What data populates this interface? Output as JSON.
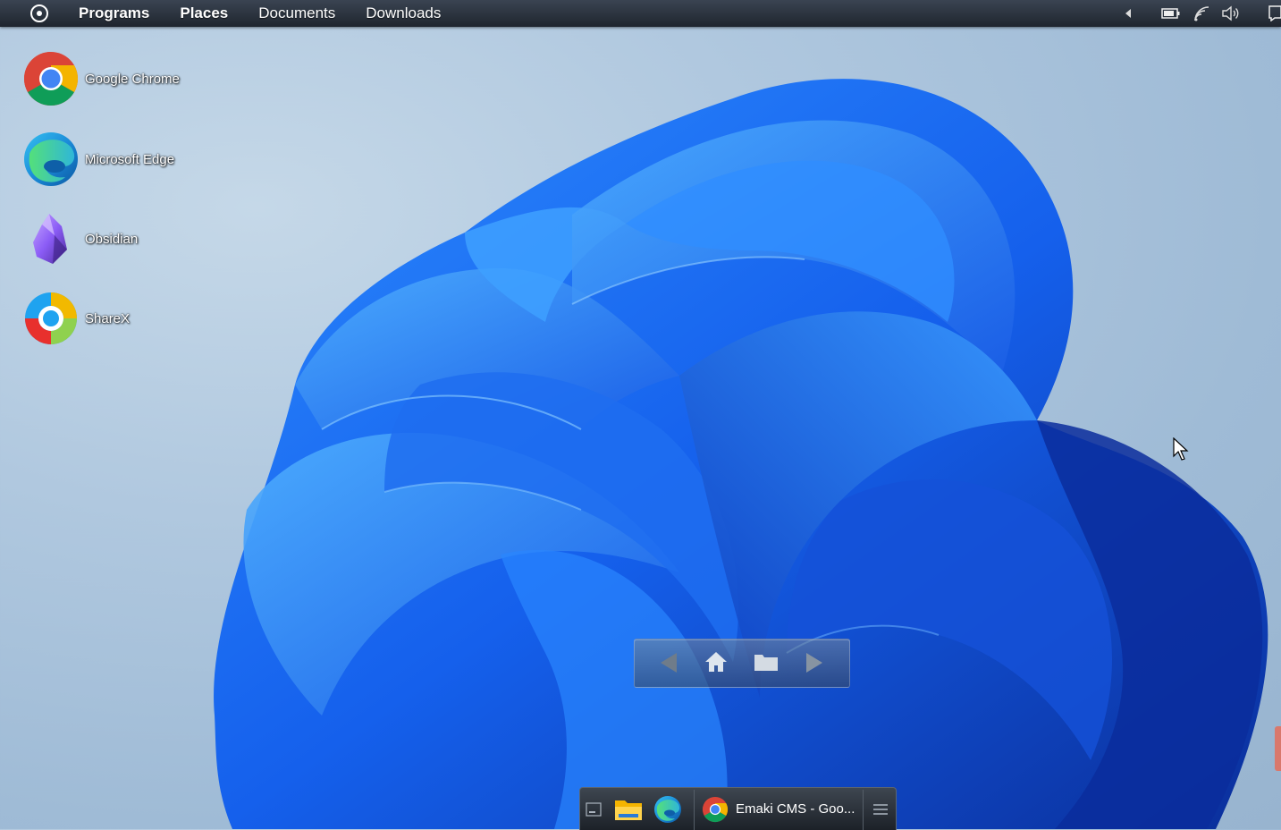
{
  "menubar": {
    "items": [
      {
        "label": "Programs",
        "bold": true
      },
      {
        "label": "Places",
        "bold": true
      },
      {
        "label": "Documents",
        "bold": false
      },
      {
        "label": "Downloads",
        "bold": false
      }
    ]
  },
  "desktop": {
    "icons": [
      {
        "label": "Google Chrome",
        "icon": "chrome-icon"
      },
      {
        "label": "Microsoft Edge",
        "icon": "edge-icon"
      },
      {
        "label": "Obsidian",
        "icon": "obsidian-icon"
      },
      {
        "label": "ShareX",
        "icon": "sharex-icon"
      }
    ]
  },
  "navbox": {
    "buttons": [
      "back-arrow-icon",
      "home-icon",
      "folder-icon",
      "forward-arrow-icon"
    ]
  },
  "dock": {
    "active_window_label": "Emaki CMS - Goo..."
  },
  "colors": {
    "menubar": "#262d37",
    "wallpaper_bg": "#a9c2da",
    "bloom": "#1a6cf0"
  }
}
